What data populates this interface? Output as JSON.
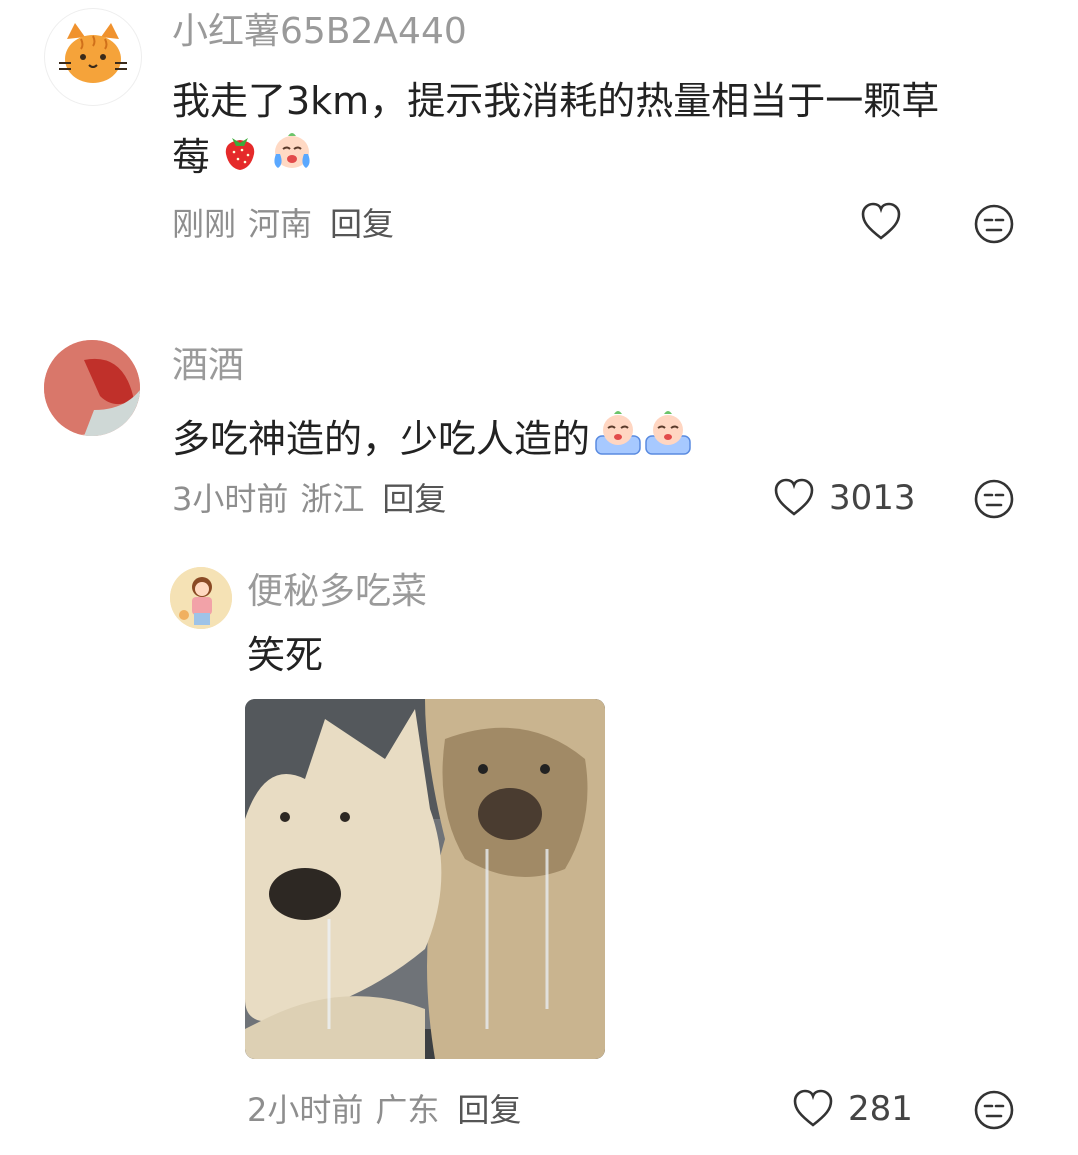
{
  "comments": [
    {
      "username": "小红薯65B2A440",
      "text_line1": "我走了3km，提示我消耗的热量相当于一颗草",
      "text_line2": "莓",
      "emojis": [
        "strawberry-emoji",
        "crying-face-emoji"
      ],
      "time": "刚刚",
      "location": "河南",
      "reply_label": "回复",
      "likes": ""
    },
    {
      "username": "酒酒",
      "text": "多吃神造的，少吃人造的",
      "emojis": [
        "crying-baby-emoji",
        "crying-baby-emoji"
      ],
      "time": "3小时前",
      "location": "浙江",
      "reply_label": "回复",
      "likes": "3013"
    },
    {
      "username": "便秘多吃菜",
      "text": "笑死",
      "image": "two-drooling-dogs-photo",
      "time": "2小时前",
      "location": "广东",
      "reply_label": "回复",
      "likes": "281"
    }
  ],
  "colors": {
    "meta": "#8e8e8e",
    "username": "#9a9a9a",
    "text": "#222222"
  }
}
